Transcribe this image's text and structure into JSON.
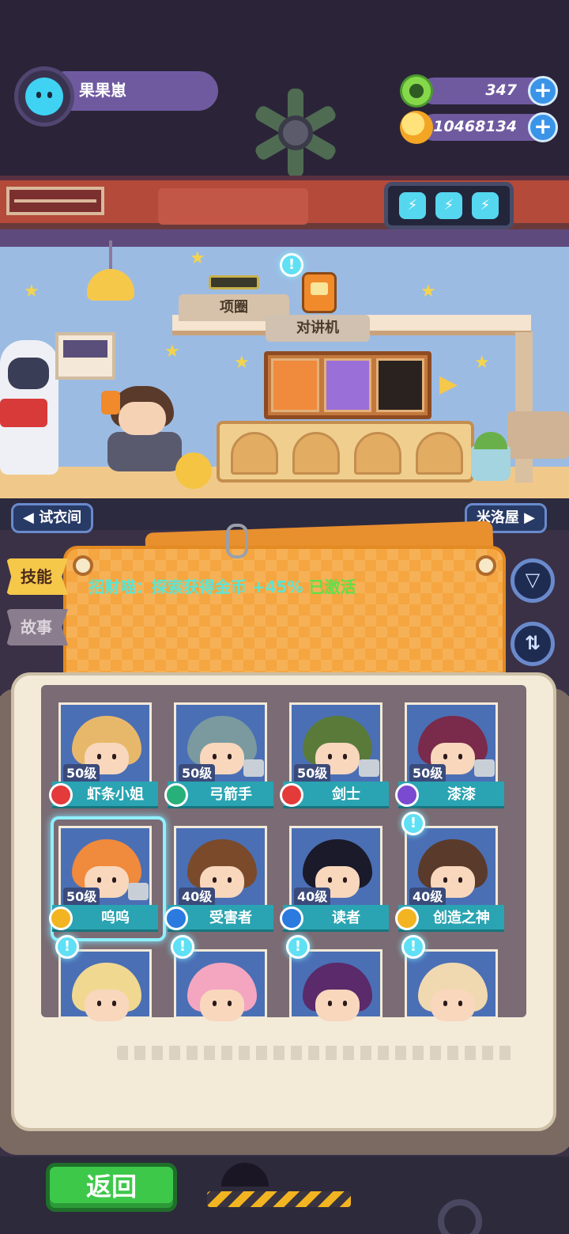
{
  "player": {
    "name": "果果崽"
  },
  "resources": {
    "gems": {
      "value": "347",
      "icon": "donut-gem-icon"
    },
    "gold": {
      "value": "10468134",
      "icon": "gold-planet-icon"
    }
  },
  "room": {
    "collar_label": "项圈",
    "walkie_label": "对讲机"
  },
  "nav": {
    "left": "试衣间",
    "right": "米洛屋",
    "left_arrow": "◀",
    "right_arrow": "▶"
  },
  "board": {
    "skill_text": "招财喵：探索获得金币 +45%",
    "skill_status": "已激活",
    "notice_glyph": "!"
  },
  "tabs": {
    "skill": "技能",
    "story": "故事"
  },
  "icons": {
    "filter": "▽",
    "sort": "⇅",
    "battery": "⚡"
  },
  "characters": [
    {
      "level": "50级",
      "name": "虾条小姐",
      "badge": "red",
      "hair": "#e8b86a",
      "bg": "#4b6fb5",
      "shirt": false,
      "notice": false,
      "selected": false
    },
    {
      "level": "50级",
      "name": "弓箭手",
      "badge": "green",
      "hair": "#7a9aa0",
      "bg": "#4b6fb5",
      "shirt": true,
      "notice": false,
      "selected": false
    },
    {
      "level": "50级",
      "name": "剑士",
      "badge": "red",
      "hair": "#5a7a3a",
      "bg": "#4b6fb5",
      "shirt": true,
      "notice": false,
      "selected": false
    },
    {
      "level": "50级",
      "name": "漆漆",
      "badge": "purple",
      "hair": "#7a2a4a",
      "bg": "#4b6fb5",
      "shirt": true,
      "notice": false,
      "selected": false
    },
    {
      "level": "50级",
      "name": "呜呜",
      "badge": "gold",
      "hair": "#f08a3c",
      "bg": "#4b6fb5",
      "shirt": true,
      "notice": false,
      "selected": true
    },
    {
      "level": "40级",
      "name": "受害者",
      "badge": "blue",
      "hair": "#7a4a2a",
      "bg": "#4b6fb5",
      "shirt": false,
      "notice": false,
      "selected": false
    },
    {
      "level": "40级",
      "name": "读者",
      "badge": "blue",
      "hair": "#1a1a2a",
      "bg": "#4b6fb5",
      "shirt": false,
      "notice": false,
      "selected": false
    },
    {
      "level": "40级",
      "name": "创造之神",
      "badge": "gold",
      "hair": "#5a3a2a",
      "bg": "#4b6fb5",
      "shirt": false,
      "notice": true,
      "selected": false
    }
  ],
  "partial_characters": [
    {
      "hair": "#f0d890",
      "notice": true
    },
    {
      "hair": "#f4a6c0",
      "notice": true
    },
    {
      "hair": "#5a2a6a",
      "notice": true
    },
    {
      "hair": "#f0d8b0",
      "notice": true
    }
  ],
  "footer": {
    "back_label": "返回"
  }
}
